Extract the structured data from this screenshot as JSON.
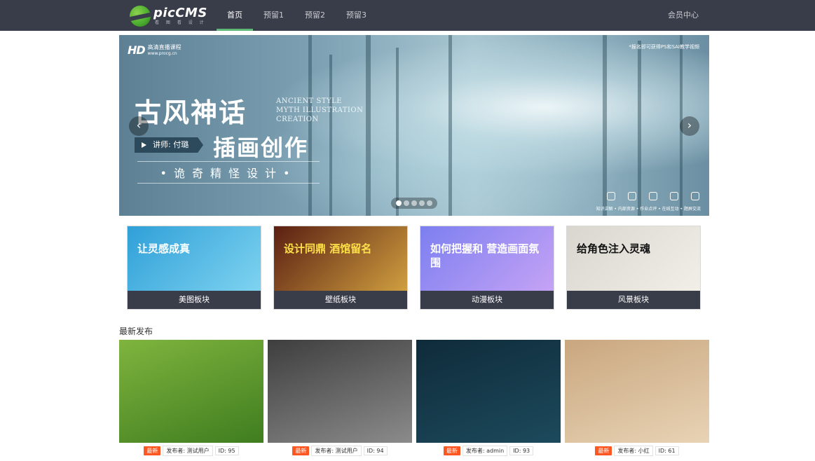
{
  "brand": {
    "name": "picCMS",
    "tagline": "看 图 看 设 计"
  },
  "nav": {
    "items": [
      {
        "label": "首页",
        "active": true
      },
      {
        "label": "预留1",
        "active": false
      },
      {
        "label": "预留2",
        "active": false
      },
      {
        "label": "预留3",
        "active": false
      }
    ],
    "member": "会员中心"
  },
  "banner": {
    "hd": "HD",
    "hd_text": "高清直播课程",
    "hd_url": "www.procg.cn",
    "note": "*报名即可获得PS和SAI教学视频",
    "title_main": "古风神话",
    "title_en": "ANCIENT STYLE MYTH ILLUSTRATION CREATION",
    "teacher": "讲师: 付璐",
    "title_sub": "插画创作",
    "title_tag": "•诡奇精怪设计•",
    "footer": "知识讲解 • 内部资源 • 作业点评 • 在线互动 • 题屏交流",
    "slide_count": 5,
    "active_slide": 0
  },
  "categories": [
    {
      "label": "美图板块",
      "colors": [
        "#2fa0d8",
        "#7fd3f0"
      ],
      "art": "让灵感成真",
      "art_color": "#ffffff"
    },
    {
      "label": "壁纸板块",
      "colors": [
        "#5a1f12",
        "#d0a040"
      ],
      "art": "设计同鼎 酒馆留名",
      "art_color": "#ffe14a"
    },
    {
      "label": "动漫板块",
      "colors": [
        "#7c7ff0",
        "#c6a3f5"
      ],
      "art": "如何把握和 营造画面氛围",
      "art_color": "#ffffff"
    },
    {
      "label": "风景板块",
      "colors": [
        "#d9d6cf",
        "#f2efe8"
      ],
      "art": "给角色注入灵魂",
      "art_color": "#111111"
    }
  ],
  "latest": {
    "title": "最新发布",
    "posts": [
      {
        "badge": "最新",
        "author": "发布者: 测试用户",
        "id": "ID: 95",
        "colors": [
          "#7fb43e",
          "#3f7d1f"
        ]
      },
      {
        "badge": "最新",
        "author": "发布者: 测试用户",
        "id": "ID: 94",
        "colors": [
          "#3e3e3e",
          "#8b8b8b"
        ]
      },
      {
        "badge": "最新",
        "author": "发布者: admin",
        "id": "ID: 93",
        "colors": [
          "#0f2b3a",
          "#1c4a5c"
        ]
      },
      {
        "badge": "最新",
        "author": "发布者: 小红",
        "id": "ID: 61",
        "colors": [
          "#c9a77f",
          "#e8d3b5"
        ]
      }
    ]
  }
}
